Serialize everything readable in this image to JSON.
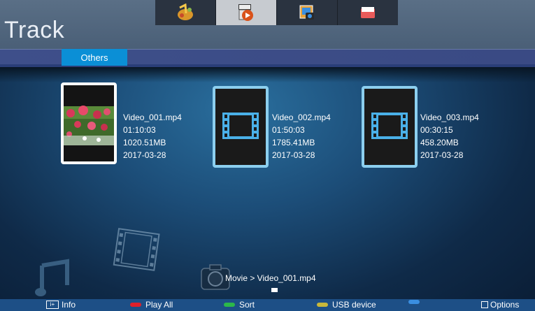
{
  "header": {
    "title": "Track",
    "app_tabs": [
      {
        "icon": "music-icon",
        "active": false
      },
      {
        "icon": "video-icon",
        "active": true
      },
      {
        "icon": "photo-icon",
        "active": false
      },
      {
        "icon": "folder-icon",
        "active": false
      }
    ]
  },
  "category": {
    "active_tab": "Others"
  },
  "files": [
    {
      "name": "Video_001.mp4",
      "duration": "01:10:03",
      "size": "1020.51MB",
      "date": "2017-03-28",
      "selected": true,
      "thumb": "flower-photo"
    },
    {
      "name": "Video_002.mp4",
      "duration": "01:50:03",
      "size": "1785.41MB",
      "date": "2017-03-28",
      "selected": false,
      "thumb": "film-icon"
    },
    {
      "name": "Video_003.mp4",
      "duration": "00:30:15",
      "size": "458.20MB",
      "date": "2017-03-28",
      "selected": false,
      "thumb": "film-icon"
    }
  ],
  "breadcrumb": "Movie > Video_001.mp4",
  "bottom_bar": {
    "info": "Info",
    "play_all": "Play All",
    "sort": "Sort",
    "usb": "USB device",
    "options": "Options",
    "colors": {
      "red": "#e0202a",
      "green": "#2cb84a",
      "yellow": "#c8b83a",
      "blue": "#3a8ee0"
    }
  }
}
